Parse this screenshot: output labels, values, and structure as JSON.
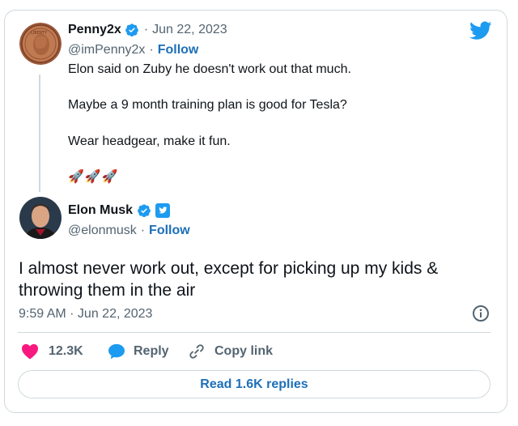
{
  "quoted": {
    "name": "Penny2x",
    "date": "Jun 22, 2023",
    "handle": "@imPenny2x",
    "follow": "Follow",
    "lines": [
      "Elon said on Zuby he doesn't work out that much.",
      "Maybe a 9 month training plan is good for Tesla?",
      "Wear headgear, make it fun.",
      "🚀🚀🚀"
    ]
  },
  "reply": {
    "name": "Elon Musk",
    "handle": "@elonmusk",
    "follow": "Follow",
    "text_line1": "I almost never work out, except for picking up my kids &",
    "text_line2": "throwing them in the air",
    "timestamp": "9:59 AM · Jun 22, 2023"
  },
  "actions": {
    "likes": "12.3K",
    "reply": "Reply",
    "copy_link": "Copy link"
  },
  "read_replies": "Read 1.6K replies",
  "separator": "·",
  "colors": {
    "accent": "#1d9bf0",
    "like": "#f91880",
    "text": "#0f1419",
    "muted": "#536471"
  }
}
